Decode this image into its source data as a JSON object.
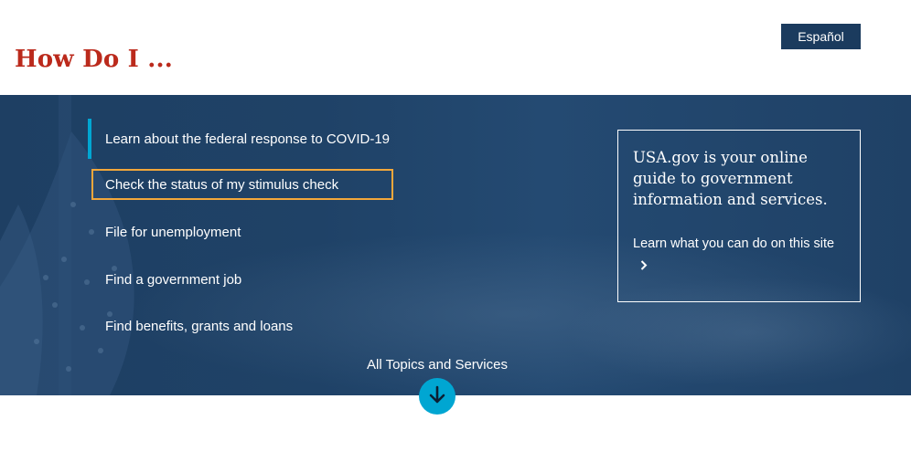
{
  "header": {
    "title": "How Do I ...",
    "language_button": "Español"
  },
  "hero": {
    "nav_items": [
      {
        "label": "Learn about the federal response to COVID-19"
      },
      {
        "label": "Check the status of my stimulus check"
      },
      {
        "label": "File for unemployment"
      },
      {
        "label": "Find a government job"
      },
      {
        "label": "Find benefits, grants and loans"
      }
    ],
    "info_box": {
      "text": "USA.gov is your online guide to government information and services.",
      "link": "Learn what you can do on this site"
    },
    "all_topics": "All Topics and Services"
  },
  "colors": {
    "title": "#bb2a1c",
    "hero_bg": "#1f4267",
    "accent": "#00a6d2",
    "focus": "#f2a73b",
    "button_bg": "#1b3b5e"
  },
  "icons": {
    "chevron": "chevron-right-icon",
    "down": "arrow-down-icon"
  }
}
